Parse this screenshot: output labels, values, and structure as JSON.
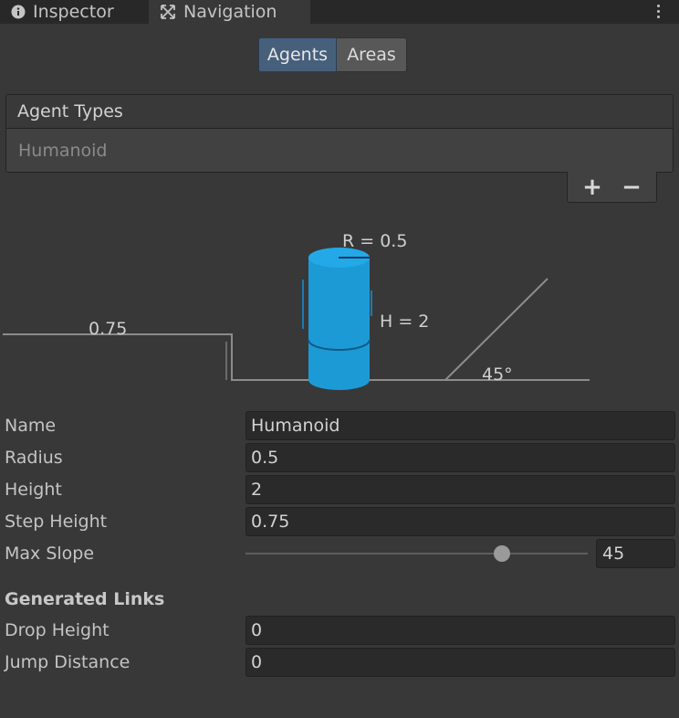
{
  "tabs": [
    {
      "label": "Inspector",
      "icon": "info-icon"
    },
    {
      "label": "Navigation",
      "icon": "navigation-icon"
    }
  ],
  "segments": [
    "Agents",
    "Areas"
  ],
  "agent_types": {
    "header": "Agent Types",
    "items": [
      "Humanoid"
    ],
    "add": "+",
    "remove": "−"
  },
  "diagram": {
    "radius_label": "R = 0.5",
    "height_label": "H = 2",
    "step_label": "0.75",
    "slope_label": "45°",
    "agent_color": "#1c9ad6"
  },
  "fields": {
    "name": {
      "label": "Name",
      "value": "Humanoid"
    },
    "radius": {
      "label": "Radius",
      "value": "0.5"
    },
    "height": {
      "label": "Height",
      "value": "2"
    },
    "step_height": {
      "label": "Step Height",
      "value": "0.75"
    },
    "max_slope": {
      "label": "Max Slope",
      "value": "45",
      "slider_fraction": 0.75
    }
  },
  "generated_links": {
    "title": "Generated Links",
    "drop_height": {
      "label": "Drop Height",
      "value": "0"
    },
    "jump_distance": {
      "label": "Jump Distance",
      "value": "0"
    }
  }
}
